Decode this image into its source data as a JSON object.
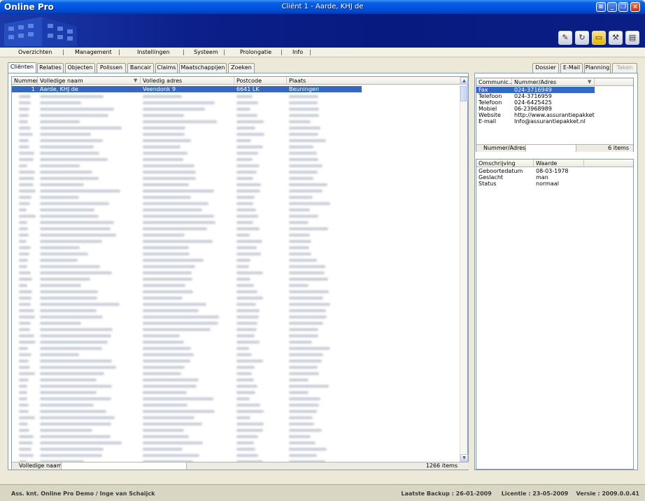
{
  "titlebar": {
    "app_name": "Online Pro",
    "window_title": "Cliënt 1 - Aarde, KHJ de"
  },
  "menu": [
    {
      "label": "Overzichten"
    },
    {
      "label": "Management"
    },
    {
      "label": "Instellingen"
    },
    {
      "label": "Systeem"
    },
    {
      "label": "Prolongatie"
    },
    {
      "label": "Info"
    }
  ],
  "left_tabs": [
    "Cliënten",
    "Relaties",
    "Objecten",
    "Polissen",
    "Bancair",
    "Claims",
    "Maatschappijen",
    "Zoeken"
  ],
  "right_tabs": [
    "Dossier",
    "E-Mail",
    "Planning",
    "Taken"
  ],
  "client_table": {
    "columns": [
      "Nummer",
      "Volledige naam",
      "Volledig adres",
      "Postcode",
      "Plaats"
    ],
    "selected_row": {
      "nummer": "1",
      "naam": "Aarde, KHJ de",
      "adres": "Veendonk 9",
      "postcode": "6641 LK",
      "plaats": "Beuningen"
    },
    "footer_sort_label": "Volledige naam",
    "footer_count": "1266 items"
  },
  "contact_table": {
    "columns": [
      "Communic...",
      "Nummer/Adres"
    ],
    "rows": [
      {
        "type": "Fax",
        "value": "024-3716949"
      },
      {
        "type": "Telefoon",
        "value": "024-3716959"
      },
      {
        "type": "Telefoon",
        "value": "024-6425425"
      },
      {
        "type": "Mobiel",
        "value": "06-23968989"
      },
      {
        "type": "Website",
        "value": "http://www.assurantiepakket.nl"
      },
      {
        "type": "E-mail",
        "value": "Info@assurantiepakket.nl"
      }
    ],
    "footer_sort_label": "Nummer/Adres",
    "footer_count": "6 items"
  },
  "details_table": {
    "columns": [
      "Omschrijving",
      "Waarde"
    ],
    "rows": [
      {
        "key": "Geboortedatum",
        "value": "08-03-1978"
      },
      {
        "key": "Geslacht",
        "value": "man"
      },
      {
        "key": "Status",
        "value": "normaal"
      }
    ]
  },
  "statusbar": {
    "left": "Ass. knt. Online Pro Demo / Inge van Schaijck",
    "backup": "Laatste Backup : 26-01-2009",
    "license": "Licentie : 23-05-2009",
    "version": "Versie : 2009.0.0.41"
  },
  "colors": {
    "title_blue": "#0054e3",
    "banner_blue": "#061a80",
    "selection": "#316ac5"
  }
}
